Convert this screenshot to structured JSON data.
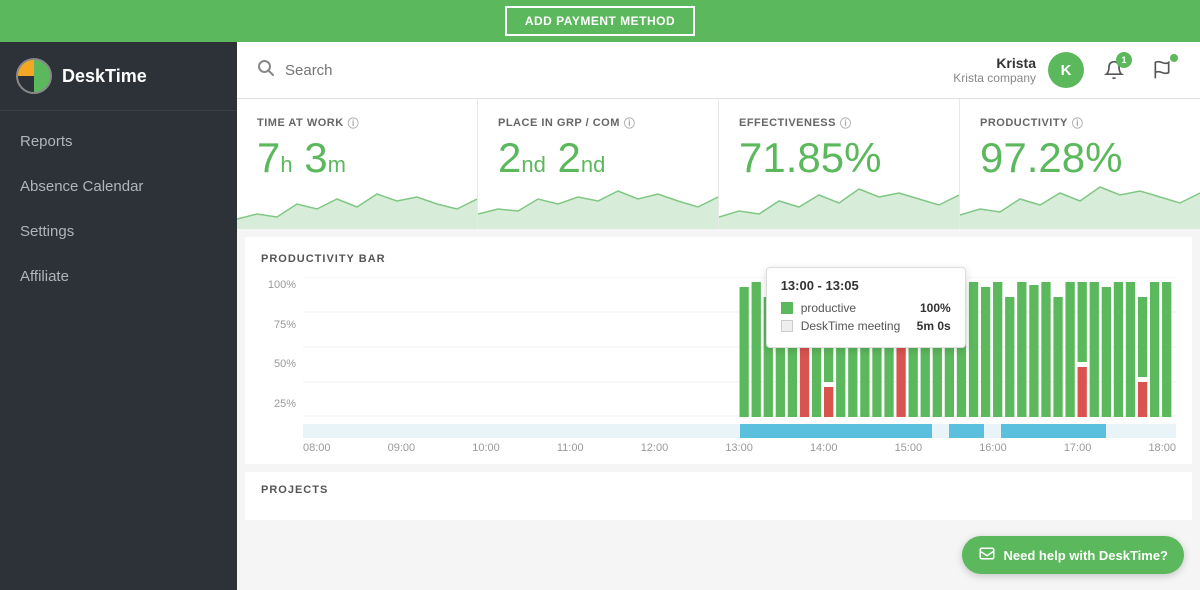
{
  "topbar": {
    "payment_btn": "ADD PAYMENT METHOD"
  },
  "sidebar": {
    "logo_text": "DeskTime",
    "items": [
      {
        "label": "Reports",
        "id": "reports"
      },
      {
        "label": "Absence Calendar",
        "id": "absence-calendar"
      },
      {
        "label": "Settings",
        "id": "settings"
      },
      {
        "label": "Affiliate",
        "id": "affiliate"
      }
    ]
  },
  "header": {
    "search_placeholder": "Search",
    "user_name": "Krista",
    "user_company": "Krista company",
    "user_initial": "K",
    "notification_count": "1"
  },
  "stats": [
    {
      "label": "TIME AT WORK",
      "value_main": "7h 3m",
      "value_h": "7h",
      "value_m": "3m"
    },
    {
      "label": "PLACE IN GRP / COM",
      "value_main": "2nd 2nd"
    },
    {
      "label": "EFFECTIVENESS",
      "value_main": "71.85%"
    },
    {
      "label": "PRODUCTIVITY",
      "value_main": "97.28%"
    }
  ],
  "productivity_bar": {
    "title": "PRODUCTIVITY BAR",
    "y_labels": [
      "100%",
      "75%",
      "50%",
      "25%"
    ],
    "x_labels": [
      "08:00",
      "09:00",
      "10:00",
      "11:00",
      "12:00",
      "13:00",
      "14:00",
      "15:00",
      "16:00",
      "17:00",
      "18:00"
    ],
    "tooltip": {
      "time": "13:00 - 13:05",
      "row1_label": "productive",
      "row1_value": "100%",
      "row2_label": "DeskTime meeting",
      "row2_value": "5m 0s"
    }
  },
  "projects": {
    "title": "PROJECTS"
  },
  "help": {
    "label": "Need help with DeskTime?"
  }
}
